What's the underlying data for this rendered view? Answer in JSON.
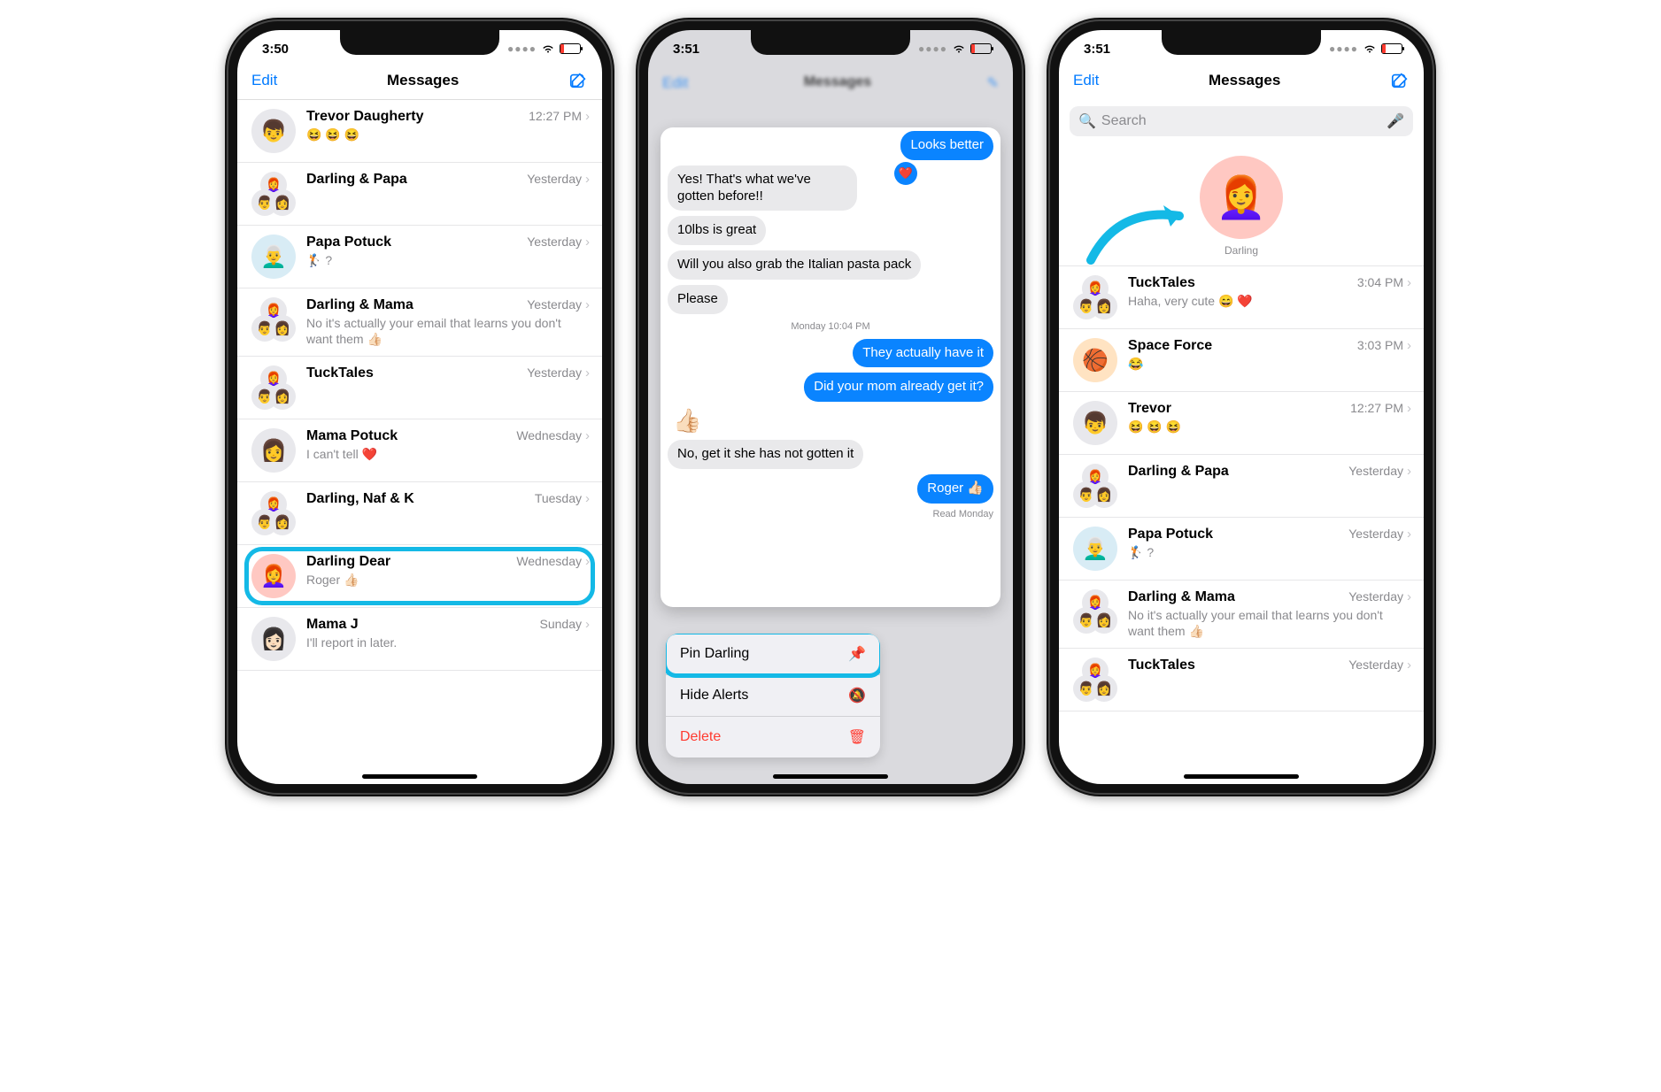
{
  "phones": {
    "p1": {
      "time": "3:50",
      "title": "Messages",
      "edit": "Edit",
      "rows": [
        {
          "name": "Trevor Daugherty",
          "time": "12:27 PM",
          "preview": "😆 😆 😆",
          "avatar": "👦"
        },
        {
          "name": "Darling & Papa",
          "time": "Yesterday",
          "preview": "",
          "avatar": "group"
        },
        {
          "name": "Papa Potuck",
          "time": "Yesterday",
          "preview": "🏌️ ?",
          "avatar": "👨‍🦳"
        },
        {
          "name": "Darling & Mama",
          "time": "Yesterday",
          "preview": "No it's actually your email that learns you don't want them 👍🏻",
          "avatar": "group"
        },
        {
          "name": "TuckTales",
          "time": "Yesterday",
          "preview": "",
          "avatar": "group"
        },
        {
          "name": "Mama Potuck",
          "time": "Wednesday",
          "preview": "I can't tell ❤️",
          "avatar": "👩"
        },
        {
          "name": "Darling, Naf & K",
          "time": "Tuesday",
          "preview": "",
          "avatar": "group"
        },
        {
          "name": "Darling Dear",
          "time": "Wednesday",
          "preview": "Roger 👍🏻",
          "avatar": "👩‍🦰",
          "hl": true
        },
        {
          "name": "Mama J",
          "time": "Sunday",
          "preview": "I'll report in later.",
          "avatar": "👩🏻"
        }
      ]
    },
    "p2": {
      "time": "3:51",
      "bubble_out_top": "Looks better",
      "bubbles_in": [
        "Yes! That's what we've gotten before!!",
        "10lbs is great",
        "Will you also grab the Italian pasta pack",
        "Please"
      ],
      "ts": "Monday 10:04 PM",
      "bubbles_out": [
        "They actually have it",
        "Did your mom already get it?"
      ],
      "thumb": "👍🏻",
      "reply_in": "No, get it she has not gotten it",
      "reply_out": "Roger 👍🏻",
      "read": "Read Monday",
      "menu": {
        "pin": "Pin Darling",
        "hide": "Hide Alerts",
        "del": "Delete"
      }
    },
    "p3": {
      "time": "3:51",
      "title": "Messages",
      "edit": "Edit",
      "search_ph": "Search",
      "pinned_name": "Darling",
      "rows": [
        {
          "name": "TuckTales",
          "time": "3:04 PM",
          "preview": "Haha, very cute 😄 ❤️",
          "avatar": "group"
        },
        {
          "name": "Space Force",
          "time": "3:03 PM",
          "preview": "😂",
          "avatar": "🏀"
        },
        {
          "name": "Trevor",
          "time": "12:27 PM",
          "preview": "😆 😆 😆",
          "avatar": "👦"
        },
        {
          "name": "Darling & Papa",
          "time": "Yesterday",
          "preview": "",
          "avatar": "group"
        },
        {
          "name": "Papa Potuck",
          "time": "Yesterday",
          "preview": "🏌️ ?",
          "avatar": "👨‍🦳"
        },
        {
          "name": "Darling & Mama",
          "time": "Yesterday",
          "preview": "No it's actually your email that learns you don't want them 👍🏻",
          "avatar": "group"
        },
        {
          "name": "TuckTales",
          "time": "Yesterday",
          "preview": "",
          "avatar": "group"
        }
      ]
    }
  }
}
